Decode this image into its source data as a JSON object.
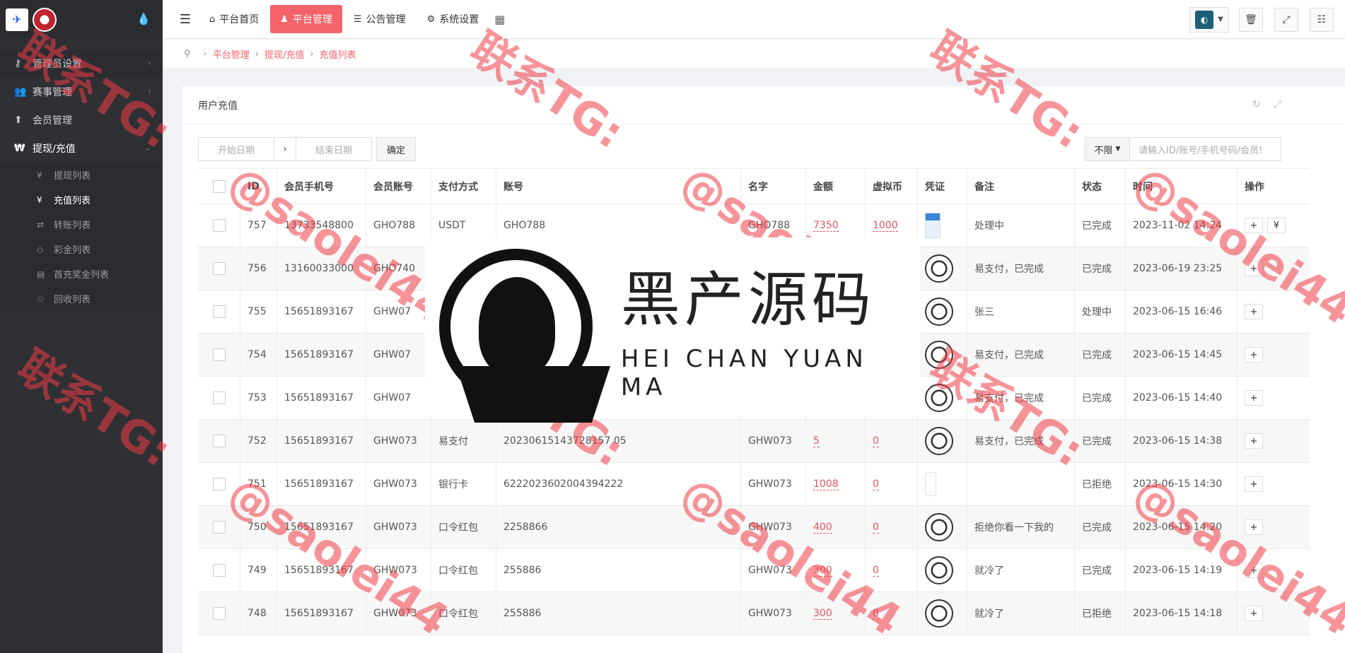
{
  "sidebar": {
    "items": [
      {
        "icon": "key-icon",
        "glyph": "⚷",
        "label": "管理员设置",
        "chevron": "‹"
      },
      {
        "icon": "users-icon",
        "glyph": "👥",
        "label": "赛事管理",
        "chevron": "‹"
      },
      {
        "icon": "arrow-up-icon",
        "glyph": "⬆",
        "label": "会员管理",
        "chevron": ""
      },
      {
        "icon": "won-icon",
        "glyph": "₩",
        "label": "提现/充值",
        "chevron": "⌄"
      }
    ],
    "subitems": [
      {
        "icon": "yen-icon",
        "glyph": "¥",
        "label": "提现列表"
      },
      {
        "icon": "yen-icon",
        "glyph": "¥",
        "label": "充值列表"
      },
      {
        "icon": "exchange-icon",
        "glyph": "⇄",
        "label": "转账列表"
      },
      {
        "icon": "diamond-icon",
        "glyph": "◇",
        "label": "彩金列表"
      },
      {
        "icon": "file-icon",
        "glyph": "▤",
        "label": "首充奖金列表"
      },
      {
        "icon": "recycle-icon",
        "glyph": "♲",
        "label": "回收列表"
      }
    ]
  },
  "topnav": {
    "items": [
      {
        "icon": "home-icon",
        "glyph": "⌂",
        "label": "平台首页"
      },
      {
        "icon": "user-icon",
        "glyph": "♟",
        "label": "平台管理"
      },
      {
        "icon": "list-icon",
        "glyph": "☰",
        "label": "公告管理"
      },
      {
        "icon": "gear-icon",
        "glyph": "⚙",
        "label": "系统设置"
      }
    ]
  },
  "breadcrumb": [
    "平台管理",
    "提现/充值",
    "充值列表"
  ],
  "card": {
    "title": "用户充值"
  },
  "filters": {
    "start_placeholder": "开始日期",
    "end_placeholder": "结束日期",
    "confirm_label": "确定",
    "limit_label": "不限",
    "search_placeholder": "请输入ID/账号/手机号码/会员!"
  },
  "table": {
    "headers": [
      "",
      "ID",
      "会员手机号",
      "会员账号",
      "支付方式",
      "账号",
      "名字",
      "金额",
      "虚拟币",
      "凭证",
      "备注",
      "状态",
      "时间",
      "操作"
    ],
    "rows": [
      {
        "id": "757",
        "phone": "13733548800",
        "account": "GHO788",
        "pay": "USDT",
        "no": "GHO788",
        "name": "GHO788",
        "amount": "7350",
        "coin": "1000",
        "cert": "img",
        "note": "处理中",
        "status": "已完成",
        "time": "2023-11-02 14:24"
      },
      {
        "id": "756",
        "phone": "13160033000",
        "account": "GHO740",
        "pay": "",
        "no": "",
        "name": "",
        "amount": "",
        "coin": "",
        "cert": "ball",
        "note": "易支付，已完成",
        "status": "已完成",
        "time": "2023-06-19 23:25"
      },
      {
        "id": "755",
        "phone": "15651893167",
        "account": "GHW07",
        "pay": "",
        "no": "",
        "name": "",
        "amount": "",
        "coin": "",
        "cert": "ball",
        "note": "张三",
        "status": "处理中",
        "time": "2023-06-15 16:46"
      },
      {
        "id": "754",
        "phone": "15651893167",
        "account": "GHW07",
        "pay": "",
        "no": "",
        "name": "",
        "amount": "",
        "coin": "",
        "cert": "ball",
        "note": "易支付，已完成",
        "status": "已完成",
        "time": "2023-06-15 14:45"
      },
      {
        "id": "753",
        "phone": "15651893167",
        "account": "GHW07",
        "pay": "",
        "no": "",
        "name": "",
        "amount": "",
        "coin": "",
        "cert": "ball",
        "note": "易支付，已完成",
        "status": "已完成",
        "time": "2023-06-15 14:40"
      },
      {
        "id": "752",
        "phone": "15651893167",
        "account": "GHW073",
        "pay": "易支付",
        "no": "20230615143728157 05",
        "name": "GHW073",
        "amount": "5",
        "coin": "0",
        "cert": "ball",
        "note": "易支付，已完成",
        "status": "已完成",
        "time": "2023-06-15 14:38"
      },
      {
        "id": "751",
        "phone": "15651893167",
        "account": "GHW073",
        "pay": "银行卡",
        "no": "6222023602004394222",
        "name": "GHW073",
        "amount": "1008",
        "coin": "0",
        "cert": "blank",
        "note": "",
        "status": "已拒绝",
        "time": "2023-06-15 14:30"
      },
      {
        "id": "750",
        "phone": "15651893167",
        "account": "GHW073",
        "pay": "口令红包",
        "no": "2258866",
        "name": "GHW073",
        "amount": "400",
        "coin": "0",
        "cert": "ball",
        "note": "拒绝你看一下我的",
        "status": "已完成",
        "time": "2023-06-15 14:20"
      },
      {
        "id": "749",
        "phone": "15651893167",
        "account": "GHW073",
        "pay": "口令红包",
        "no": "255886",
        "name": "GHW073",
        "amount": "300",
        "coin": "0",
        "cert": "ball",
        "note": "就冷了",
        "status": "已完成",
        "time": "2023-06-15 14:19"
      },
      {
        "id": "748",
        "phone": "15651893167",
        "account": "GHW073",
        "pay": "口令红包",
        "no": "255886",
        "name": "GHW073",
        "amount": "300",
        "coin": "0",
        "cert": "ball",
        "note": "就冷了",
        "status": "已拒绝",
        "time": "2023-06-15 14:18"
      }
    ]
  },
  "watermark": {
    "text1": "联系TG:",
    "text2": "@saolei44"
  },
  "overlay_logo": {
    "cn": "黑产源码",
    "en": "HEI CHAN YUAN MA"
  },
  "colors": {
    "accent": "#f4636a",
    "sidebar_bg": "#2f3034"
  }
}
